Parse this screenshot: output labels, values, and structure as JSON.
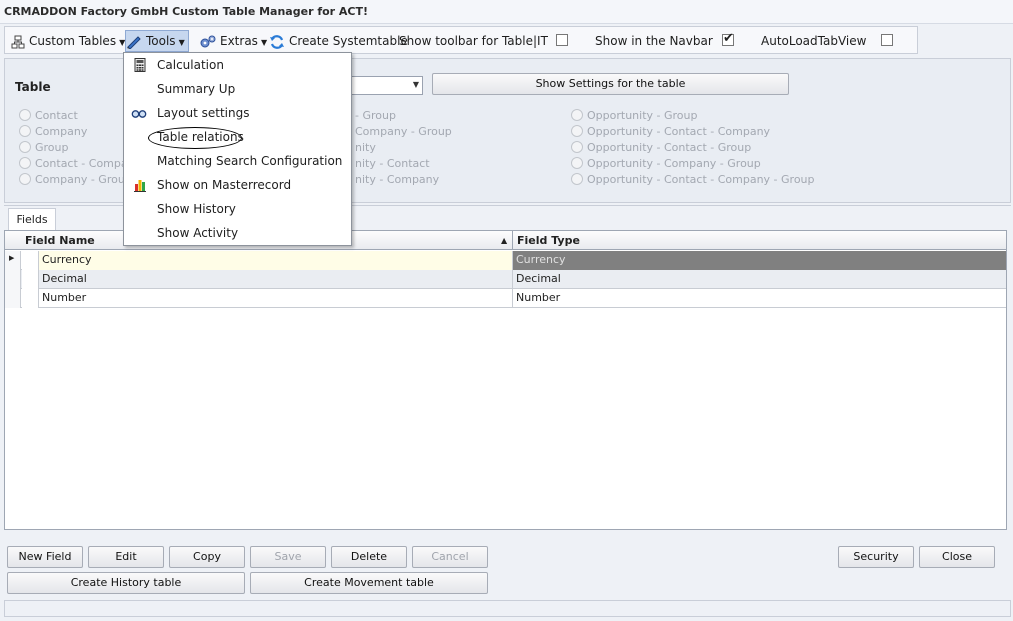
{
  "window": {
    "title": "CRMADDON Factory GmbH Custom Table Manager for ACT!"
  },
  "toolbar": {
    "custom_tables": "Custom Tables",
    "tools": "Tools",
    "extras": "Extras",
    "create_systemtable": "Create Systemtable",
    "show_toolbar_label": "Show toolbar for Table|IT",
    "show_toolbar_checked": false,
    "show_navbar_label": "Show in the Navbar",
    "show_navbar_checked": true,
    "autoload_label": "AutoLoadTabView",
    "autoload_checked": false
  },
  "tools_menu": {
    "items": [
      {
        "label": "Calculation",
        "icon": "calculator-icon"
      },
      {
        "label": "Summary Up",
        "icon": ""
      },
      {
        "label": "Layout settings",
        "icon": "glasses-icon"
      },
      {
        "label": "Table relations",
        "icon": "",
        "highlighted": true
      },
      {
        "label": "Matching Search Configuration",
        "icon": ""
      },
      {
        "label": "Show on Masterrecord",
        "icon": "bar-chart-icon"
      },
      {
        "label": "Show History",
        "icon": ""
      },
      {
        "label": "Show Activity",
        "icon": ""
      }
    ]
  },
  "table_section": {
    "label": "Table",
    "show_settings_button": "Show Settings for the table",
    "radio_col1": [
      "Contact",
      "Company",
      "Group",
      "Contact - Compan",
      "Company - Group"
    ],
    "radio_col2": [
      "- Group",
      "Company - Group",
      "nity",
      "nity - Contact",
      "nity - Company"
    ],
    "radio_col3": [
      "Opportunity - Group",
      "Opportunity - Contact - Company",
      "Opportunity - Contact - Group",
      "Opportunity - Company - Group",
      "Opportunity - Contact - Company - Group"
    ]
  },
  "fields_tab": {
    "tab_label": "Fields",
    "columns": [
      "Field Name",
      "Field Type"
    ],
    "rows": [
      {
        "name": "Currency",
        "type": "Currency"
      },
      {
        "name": "Decimal",
        "type": "Decimal"
      },
      {
        "name": "Number",
        "type": "Number"
      }
    ]
  },
  "buttons": {
    "new_field": "New Field",
    "edit": "Edit",
    "copy": "Copy",
    "save": "Save",
    "delete": "Delete",
    "cancel": "Cancel",
    "security": "Security",
    "close": "Close",
    "create_history_table": "Create History table",
    "create_movement_table": "Create Movement table"
  },
  "colors": {
    "menu_highlight": "#c6d7ef",
    "selected_row": "#fffde7",
    "selected_type_cell": "#808080"
  }
}
